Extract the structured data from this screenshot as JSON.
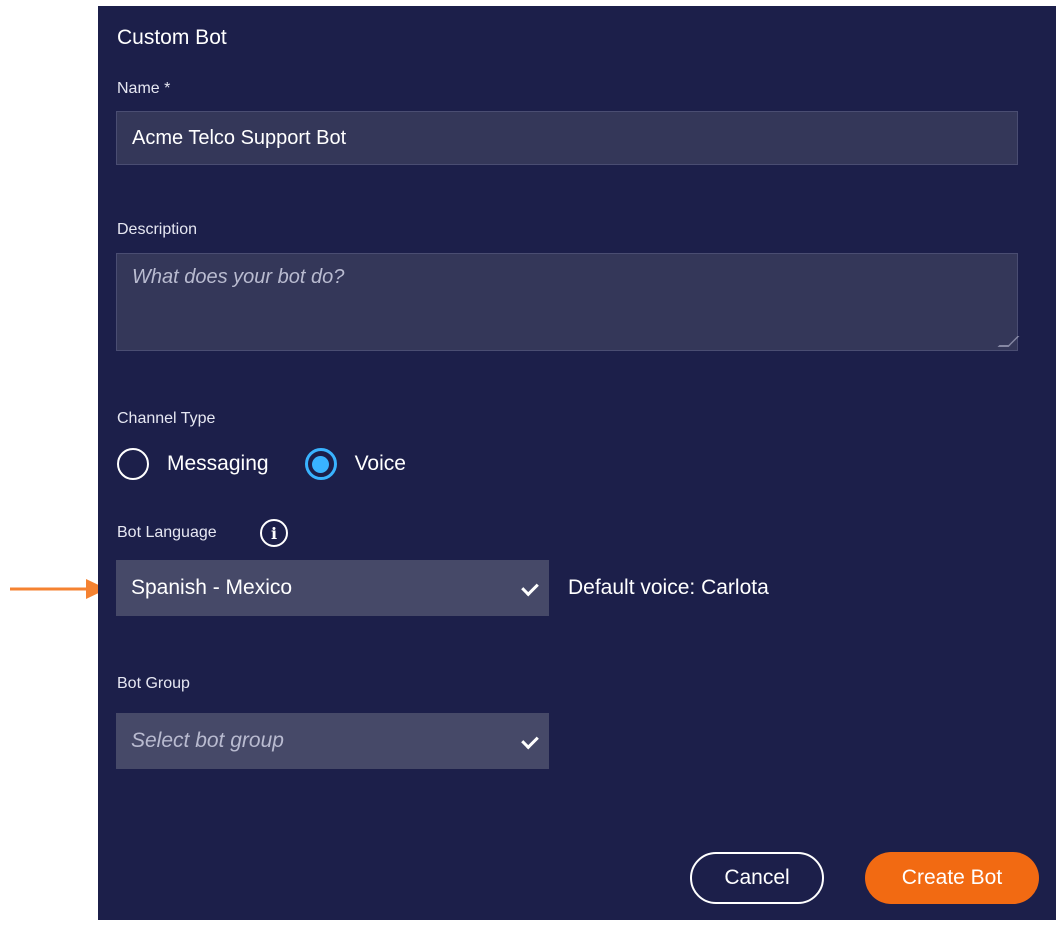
{
  "form": {
    "title": "Custom Bot",
    "name": {
      "label": "Name *",
      "value": "Acme Telco Support Bot"
    },
    "description": {
      "label": "Description",
      "placeholder": "What does your bot do?"
    },
    "channel_type": {
      "label": "Channel Type",
      "options": [
        {
          "label": "Messaging",
          "selected": false
        },
        {
          "label": "Voice",
          "selected": true
        }
      ]
    },
    "bot_language": {
      "label": "Bot Language",
      "value": "Spanish - Mexico",
      "hint": "Default voice: Carlota",
      "info_icon": "info-icon"
    },
    "bot_group": {
      "label": "Bot Group",
      "placeholder": "Select bot group"
    },
    "buttons": {
      "cancel": "Cancel",
      "create": "Create Bot"
    }
  },
  "colors": {
    "panel_bg": "#1c1f4a",
    "input_bg": "#343759",
    "select_bg": "#464968",
    "radio_accent": "#39b3ff",
    "primary_button": "#f26a12",
    "annotation_arrow": "#f58231"
  }
}
